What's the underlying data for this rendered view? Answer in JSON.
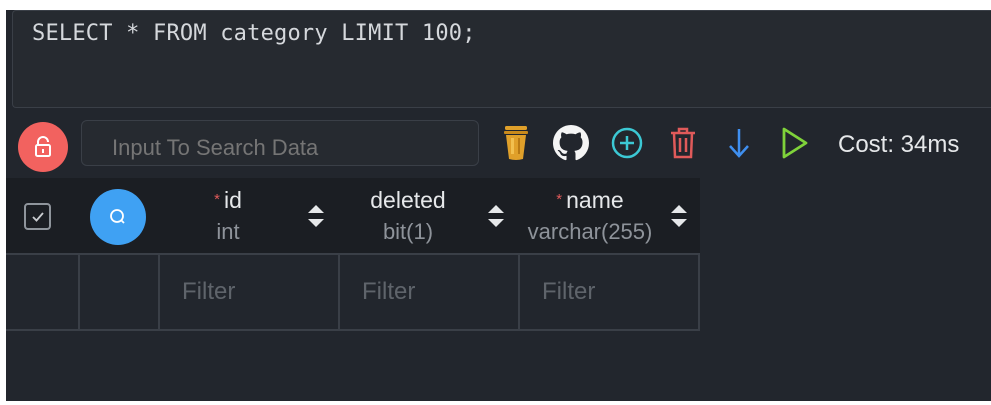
{
  "editor": {
    "sql": "SELECT * FROM category LIMIT 100;"
  },
  "toolbar": {
    "lock_icon": "unlock-icon",
    "search_placeholder": "Input To Search Data",
    "icons": [
      "bucket-icon",
      "github-icon",
      "add-circle-icon",
      "trash-icon",
      "arrow-down-icon",
      "play-icon"
    ],
    "cost_text": "Cost: 34ms"
  },
  "grid": {
    "columns": [
      {
        "name": "id",
        "type": "int",
        "required": true
      },
      {
        "name": "deleted",
        "type": "bit(1)",
        "required": false
      },
      {
        "name": "name",
        "type": "varchar(255)",
        "required": true
      }
    ],
    "required_mark": "*",
    "filter_placeholder": "Filter"
  },
  "colors": {
    "background": "#22262d",
    "lock_button": "#f2625f",
    "search_button": "#3fa1f3",
    "bucket": "#e0a02a",
    "add": "#3cc8d4",
    "trash": "#e05a5a",
    "arrow": "#3f8ff0",
    "play": "#7fd23a"
  }
}
